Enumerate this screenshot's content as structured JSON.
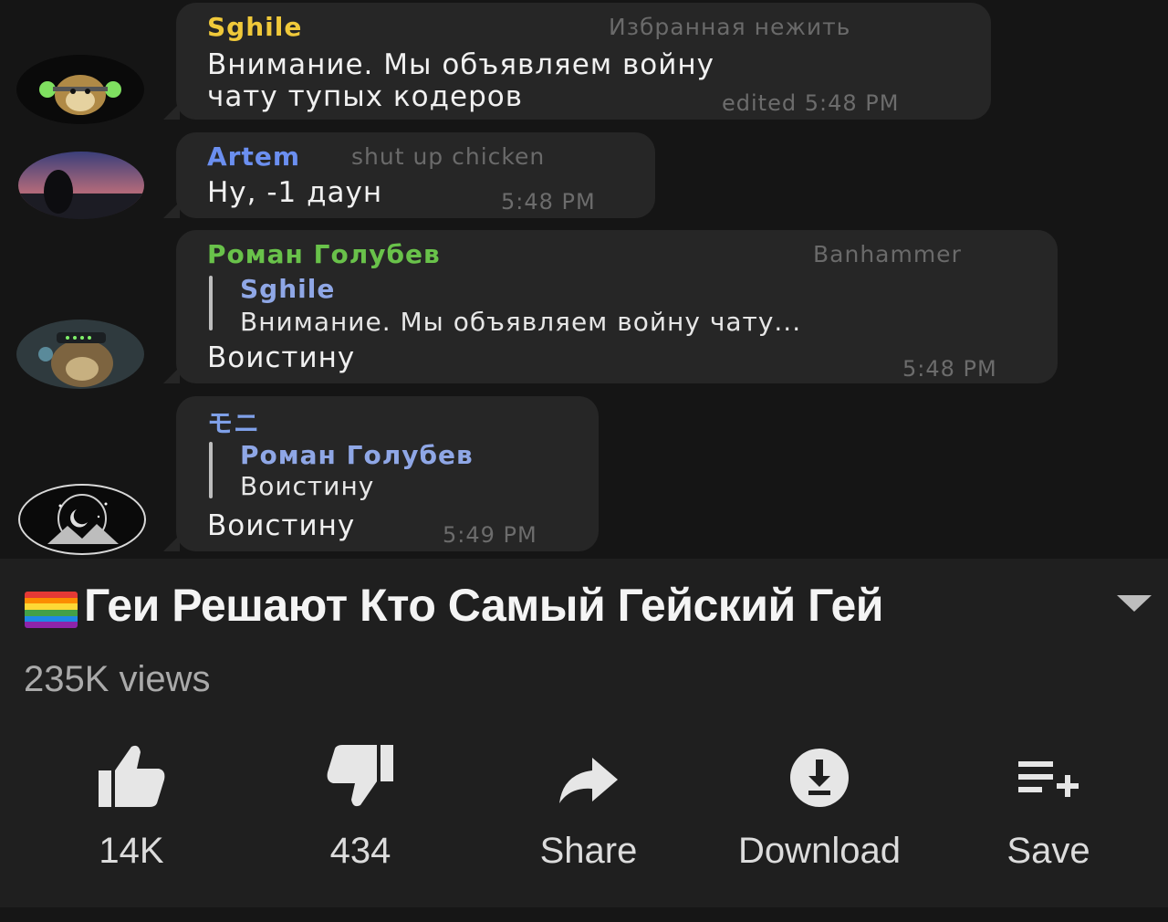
{
  "chat": {
    "messages": [
      {
        "author": "Sghile",
        "author_color": "#f0c93a",
        "rank": "Избранная нежить",
        "text_line1": "Внимание. Мы объявляем войну",
        "text_line2": "чату тупых кодеров",
        "time": "edited 5:48 PM"
      },
      {
        "author": "Artem",
        "author_color": "#6b8ff0",
        "rank": "shut up chicken",
        "text": "Ну, -1 даун",
        "time": "5:48 PM"
      },
      {
        "author": "Роман Голубев",
        "author_color": "#69c24a",
        "rank": "Banhammer",
        "reply_author": "Sghile",
        "reply_author_color": "#8fa7e6",
        "reply_text": "Внимание. Мы объявляем войну чату...",
        "text": "Воистину",
        "time": "5:48 PM"
      },
      {
        "author": "モニ",
        "author_color": "#7fa0e8",
        "reply_author": "Роман Голубев",
        "reply_author_color": "#8fa7e6",
        "reply_text": "Воистину",
        "text": "Воистину",
        "time": "5:49 PM"
      }
    ]
  },
  "video": {
    "title": "Геи Решают Кто Самый Гейский Гей",
    "views": "235K views",
    "expand_icon": "chevron-down-icon",
    "actions": [
      {
        "icon": "thumbs-up-icon",
        "label": "14K"
      },
      {
        "icon": "thumbs-down-icon",
        "label": "434"
      },
      {
        "icon": "share-icon",
        "label": "Share"
      },
      {
        "icon": "download-icon",
        "label": "Download"
      },
      {
        "icon": "save-playlist-icon",
        "label": "Save"
      }
    ]
  }
}
